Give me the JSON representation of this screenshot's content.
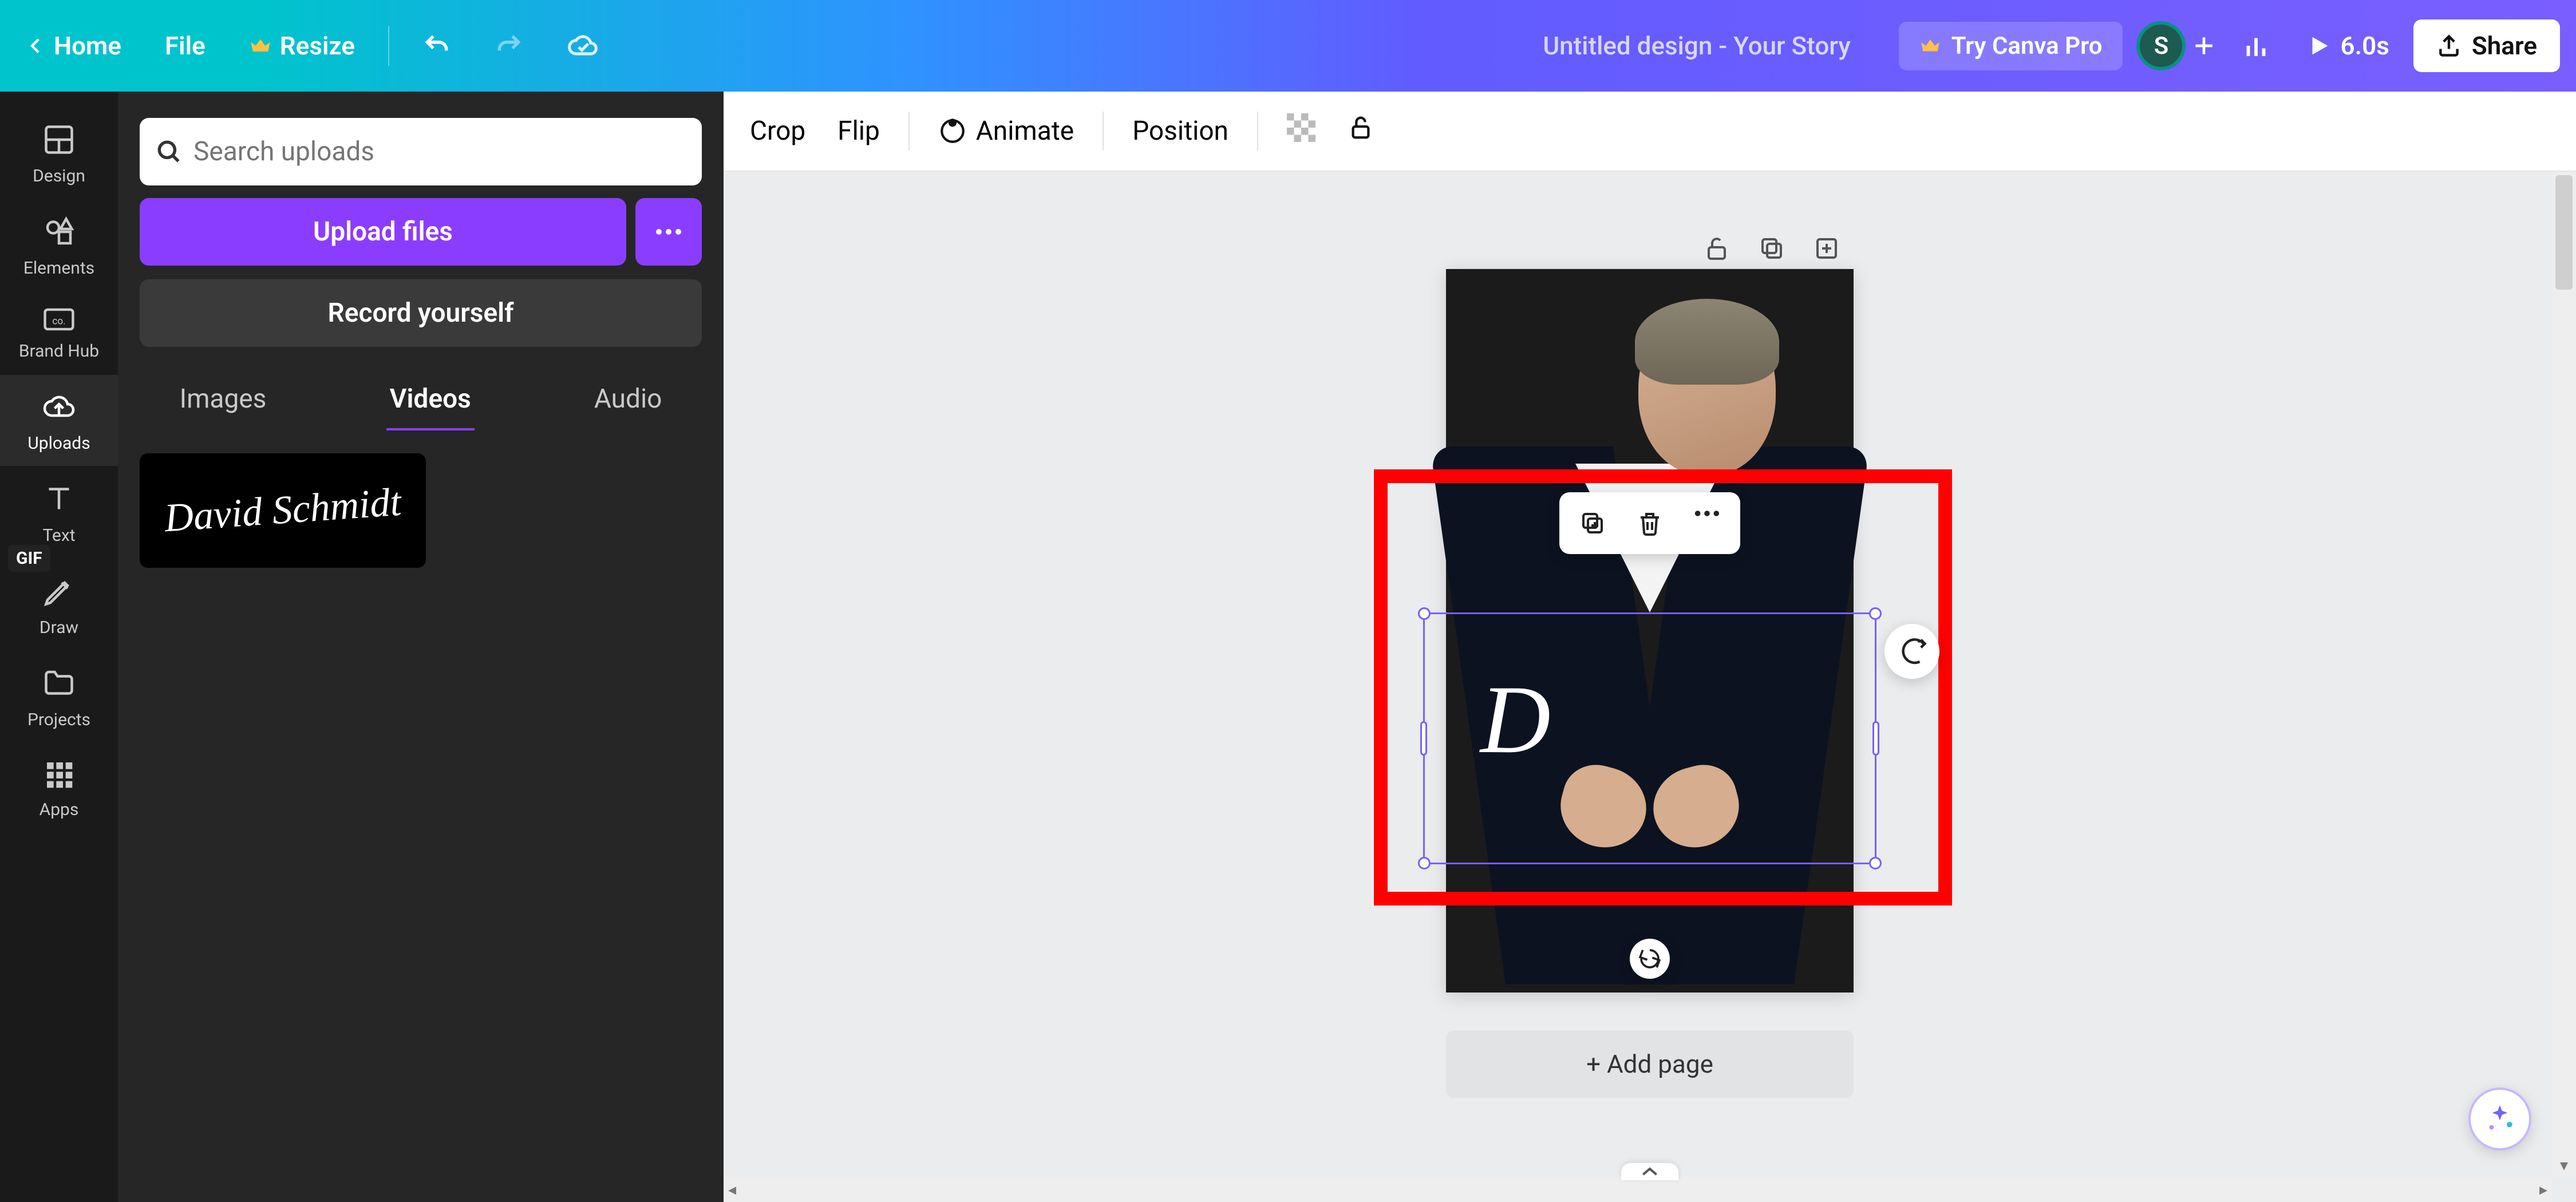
{
  "header": {
    "home": "Home",
    "file": "File",
    "resize": "Resize",
    "doc_title": "Untitled design - Your Story",
    "try_pro": "Try Canva Pro",
    "avatar_initial": "S",
    "duration": "6.0s",
    "share": "Share"
  },
  "toolbar": {
    "crop": "Crop",
    "flip": "Flip",
    "animate": "Animate",
    "position": "Position"
  },
  "rail": {
    "design": "Design",
    "elements": "Elements",
    "brand": "Brand Hub",
    "uploads": "Uploads",
    "text": "Text",
    "draw": "Draw",
    "projects": "Projects",
    "apps": "Apps"
  },
  "panel": {
    "search_placeholder": "Search uploads",
    "upload": "Upload files",
    "record": "Record yourself",
    "tabs": {
      "images": "Images",
      "videos": "Videos",
      "audio": "Audio"
    },
    "signature_text": "David Schmidt",
    "gif": "GIF"
  },
  "canvas": {
    "signature_letter": "D",
    "add_page": "+ Add page"
  }
}
